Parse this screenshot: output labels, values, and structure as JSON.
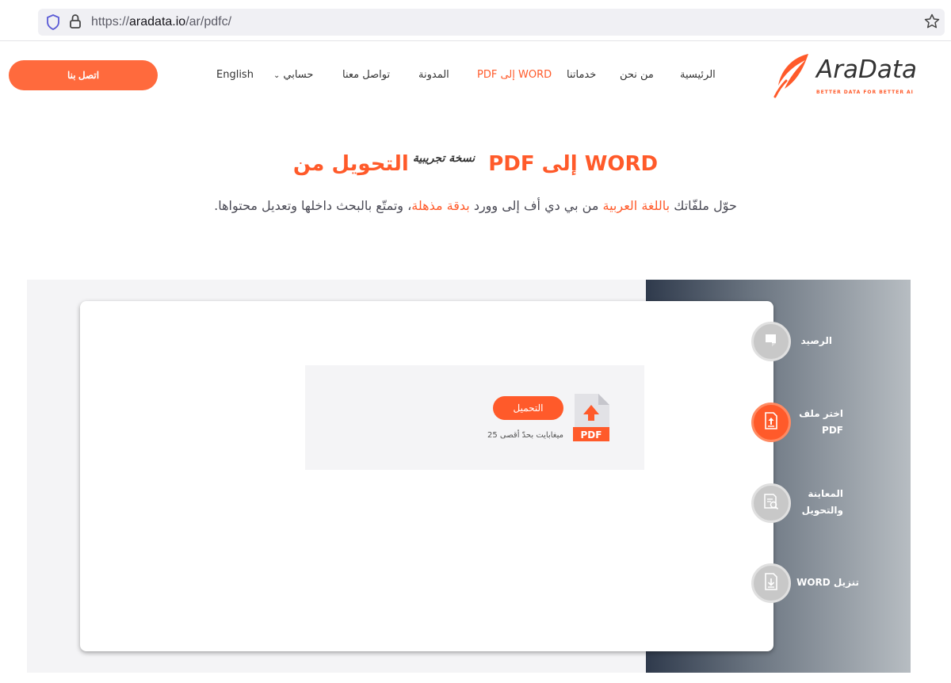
{
  "browser": {
    "url_prefix": "https://",
    "url_host": "aradata.io",
    "url_path": "/ar/pdfc/"
  },
  "header": {
    "logo_text": "AraData",
    "logo_tagline": "BETTER DATA FOR BETTER AI",
    "contact_label": "اتصل بنا",
    "nav": {
      "home": "الرئيسية",
      "about": "من نحن",
      "services": "خدماتنا",
      "pdf_word": "PDF إلى WORD",
      "blog": "المدونة",
      "contact": "تواصل معنا",
      "account": "حسابي",
      "english": "English"
    }
  },
  "hero": {
    "title": "التحويل من PDF إلى WORD",
    "title_tag": "نسخة تجريبية",
    "subtitle_1": "حوّل ملفّاتك ",
    "subtitle_hl1": "باللغة العربية",
    "subtitle_2": " من بي دي أف إلى وورد ",
    "subtitle_hl2": "بدقة مذهلة",
    "subtitle_3": "، وتمتّع بالبحث داخلها وتعديل محتواها."
  },
  "upload": {
    "button_label": "التحميل",
    "limit_text": "25 ميغابايت بحدّ أقصى",
    "file_badge": "PDF"
  },
  "steps": [
    {
      "label": "الرصيد",
      "icon": "receipt-icon",
      "active": false
    },
    {
      "label": "اختر ملف PDF",
      "icon": "upload-file-icon",
      "active": true
    },
    {
      "label": "المعاينة والتحويل",
      "icon": "preview-search-icon",
      "active": false
    },
    {
      "label": "تنزيل WORD",
      "icon": "download-file-icon",
      "active": false
    }
  ],
  "colors": {
    "accent": "#ff5a2a",
    "button": "#ff6a3d"
  }
}
